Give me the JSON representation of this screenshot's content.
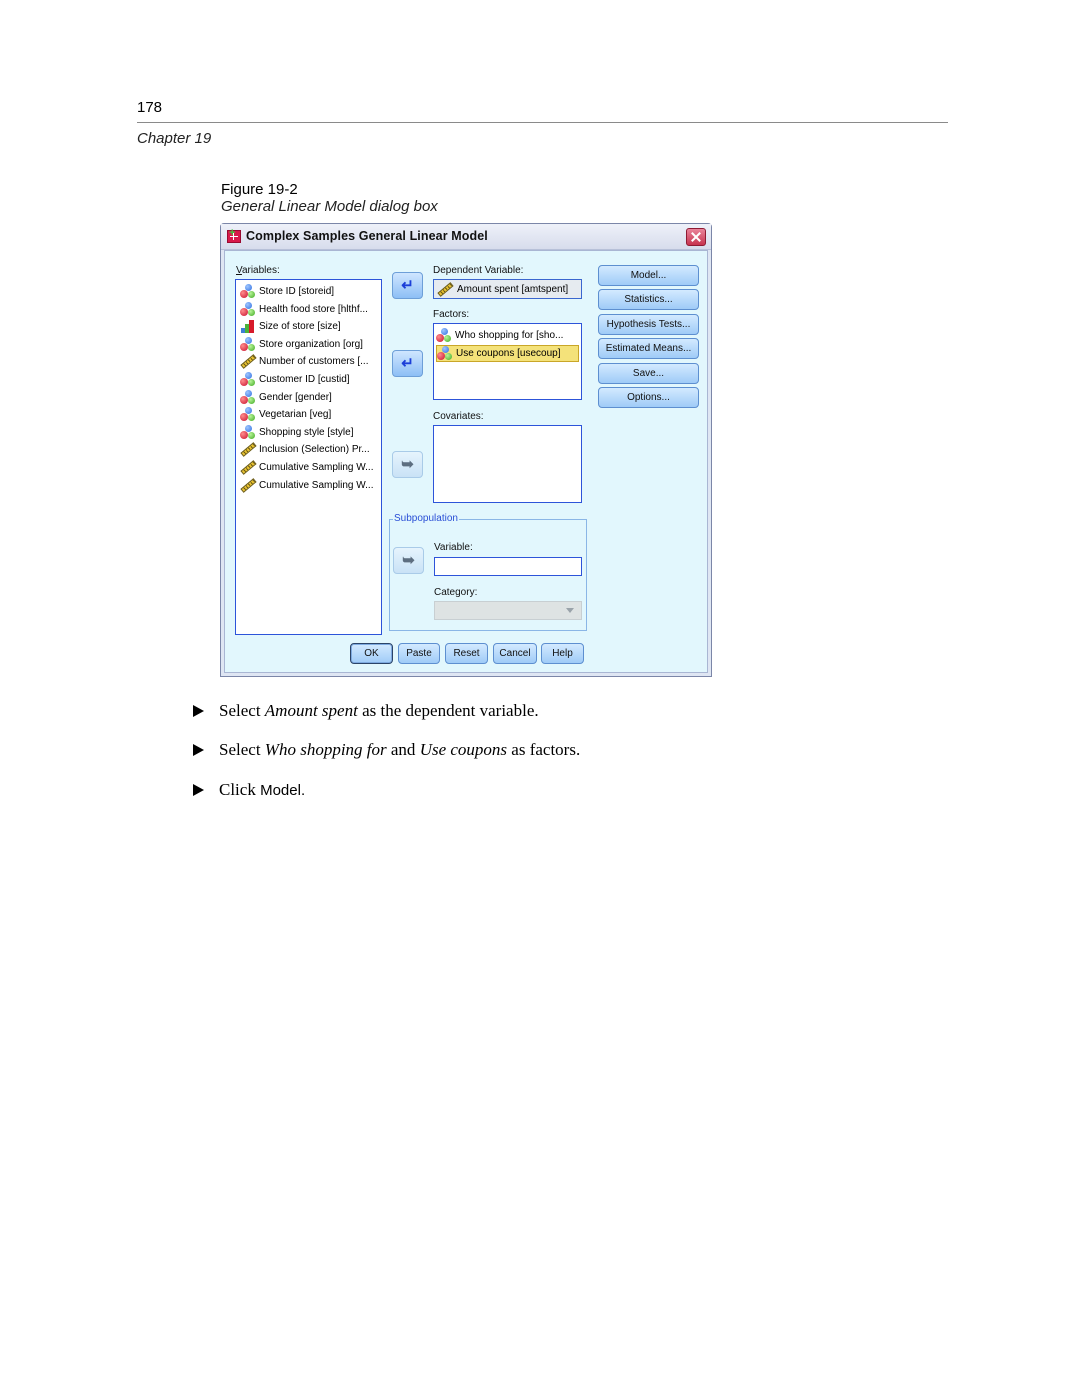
{
  "page": {
    "number": "178",
    "chapter": "Chapter 19",
    "figure_label": "Figure 19-2",
    "figure_caption": "General Linear Model dialog box"
  },
  "dialog": {
    "title": "Complex Samples General Linear Model",
    "variables_label": "Variables:",
    "variables": [
      {
        "label": "Store ID [storeid]",
        "icon": "nominal-icon"
      },
      {
        "label": "Health food store [hlthf...",
        "icon": "nominal-icon"
      },
      {
        "label": "Size of store [size]",
        "icon": "ordinal-icon"
      },
      {
        "label": "Store organization [org]",
        "icon": "nominal-icon"
      },
      {
        "label": "Number of customers [...",
        "icon": "scale-icon"
      },
      {
        "label": "Customer ID [custid]",
        "icon": "nominal-icon"
      },
      {
        "label": "Gender [gender]",
        "icon": "nominal-icon"
      },
      {
        "label": "Vegetarian [veg]",
        "icon": "nominal-icon"
      },
      {
        "label": "Shopping style [style]",
        "icon": "nominal-icon"
      },
      {
        "label": "Inclusion (Selection) Pr...",
        "icon": "scale-icon"
      },
      {
        "label": "Cumulative Sampling W...",
        "icon": "scale-icon"
      },
      {
        "label": "Cumulative Sampling W...",
        "icon": "scale-icon"
      }
    ],
    "dependent_label": "Dependent Variable:",
    "dependent_value": "Amount spent [amtspent]",
    "factors_label": "Factors:",
    "factors": [
      {
        "label": "Who shopping for [sho...",
        "icon": "nominal-icon",
        "selected": false
      },
      {
        "label": "Use coupons [usecoup]",
        "icon": "nominal-icon",
        "selected": true
      }
    ],
    "covariates_label": "Covariates:",
    "subpopulation": {
      "title": "Subpopulation",
      "variable_label": "Variable:",
      "variable_value": "",
      "category_label": "Category:",
      "category_value": ""
    },
    "side_buttons": [
      "Model...",
      "Statistics...",
      "Hypothesis Tests...",
      "Estimated Means...",
      "Save...",
      "Options..."
    ],
    "bottom_buttons": [
      "OK",
      "Paste",
      "Reset",
      "Cancel",
      "Help"
    ],
    "arrow_glyphs": {
      "move_back": "↵",
      "move_in": "➥"
    }
  },
  "instructions": {
    "bullet": "►",
    "step1": {
      "pre": "Select ",
      "em": "Amount spent",
      "post": " as the dependent variable."
    },
    "step2": {
      "pre": "Select ",
      "em1": "Who shopping for",
      "mid": " and ",
      "em2": "Use coupons",
      "post": " as factors."
    },
    "step3": {
      "pre": "Click ",
      "ui": "Model",
      "post": "."
    }
  }
}
